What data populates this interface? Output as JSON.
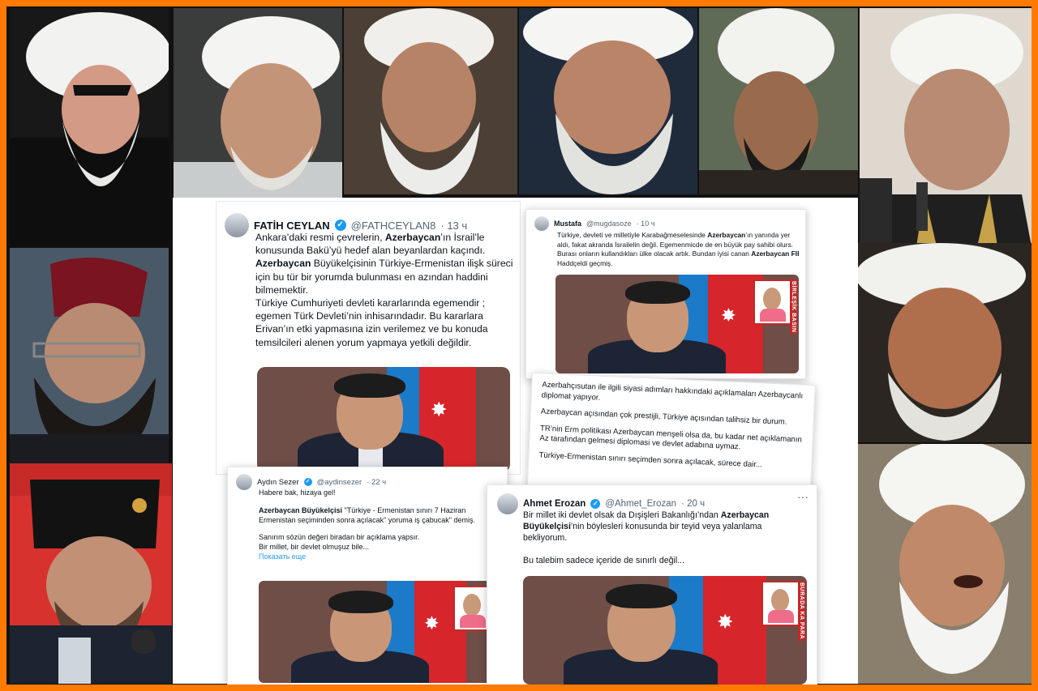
{
  "tweet_fatih": {
    "name": "FATİH CEYLAN",
    "handle": "@FATHCEYLAN8",
    "time": "· 13 ч",
    "text_html": "Ankara’daki resmi çevrelerin, <b>Azerbaycan</b>’ın İsrail’le konusunda Bakü’yü hedef alan beyanlardan kaçındı. <b>Azerbaycan</b> Büyükelçisinin Türkiye-Ermenistan ilişk süreci için bu tür bir yorumda bulunması en azından haddini bilmemektir.<br>Türkiye Cumhuriyeti devleti kararlarında egemendir ; egemen Türk Devleti’nin inhisarındadır. Bu kararlara Erivan’ın etki yapmasına izin verilemez ve bu konuda temsilcileri alenen yorum yapmaya yetkili değildir."
  },
  "tweet_mustafa": {
    "name": "Mustafa",
    "handle": "@mugdasoze",
    "time": "· 10 ч",
    "text_html": "Türkiye, devleti ve milletiyle Karabağmeselesinde <b>Azerbaycan</b>’ın yanında yer aldı, fakat akranda İsrailelin değil. Egemenmicde de en büyük pay sahibi olurs. Burası onların kullandıkları ülke olacak artık. Bundan iyisi canan <b>Azerbaycan FII</b> Haddçeldi geçmiş."
  },
  "tweet_thread": {
    "paragraphs": [
      "Azerbahçısutan ile ilgili siyasi adımları hakkındaki açıklamaları Azerbaycanlı diplomat yapıyor.",
      "Azerbaycan açısından çok prestijli, Türkiye açısından talihsiz bir durum.",
      "TR’nin Erm politikası Azerbaycan menşeli olsa da, bu kadar net açıklamanın Az tarafından gelmesi diplomasi ve devlet adabına uymaz.",
      "Türkiye-Ermenistan sınırı seçimden sonra açılacak, sürece dair..."
    ]
  },
  "tweet_aydin": {
    "name": "Aydın Sezer",
    "handle": "@aydinsezer",
    "time": "· 22 ч",
    "line1": "Habere bak, hizaya gel!",
    "text_html": "<b>Azerbaycan Büyükelçisi</b> \"Türkiye - Ermenistan sınırı 7 Haziran Ermenistan seçiminden sonra açılacak\" yoruma iş çabucak\" demiş.",
    "line3": "Sanırım sözün değeri biradan bir açıklama yapsır.",
    "line4": "Bir millet, bir devlet olmuşuz bile...",
    "more": "Показать еще"
  },
  "tweet_ahmet": {
    "name": "Ahmet Erozan",
    "handle": "@Ahmet_Erozan",
    "time": "· 20 ч",
    "dots": "···",
    "text_html": "Bir millet iki devlet olsak da Dışişleri Bakanlığı’ndan <b>Azerbaycan Büyükelçisi</b>’nin böylesleri konusunda bir teyid veya yalanlama bekliyorum.",
    "line2": "Bu talebim sadece içeride de sınırlı değil..."
  },
  "watermark_text": "BİRLEŞİK BASIN",
  "watermark_text2": "BURADA KA PARA",
  "colors": {
    "frame": "#ff7a00",
    "verified": "#1d9bf0",
    "flag_red": "#d6252b",
    "flag_blue": "#1b7bc8"
  }
}
